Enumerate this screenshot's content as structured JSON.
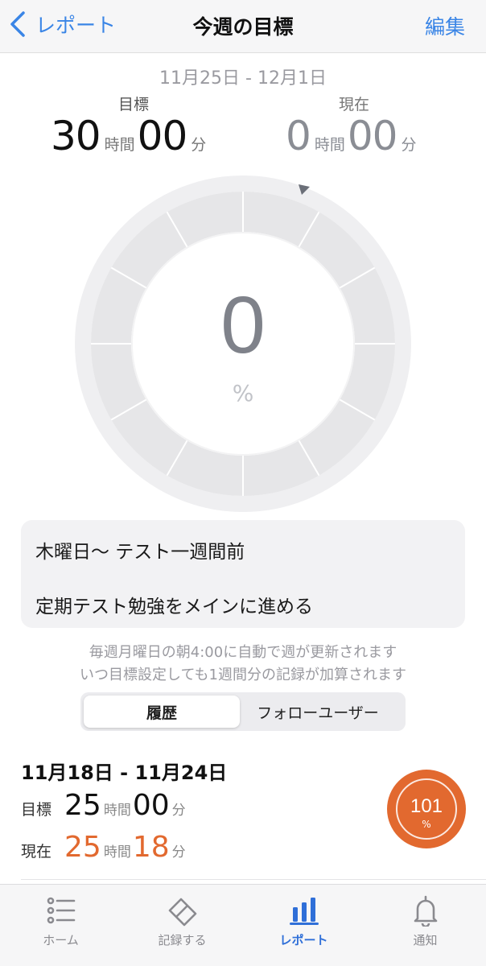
{
  "nav": {
    "back_label": "レポート",
    "title": "今週の目標",
    "edit_label": "編集"
  },
  "week": {
    "date_range": "11月25日 - 12月1日",
    "goal_label": "目標",
    "current_label": "現在",
    "goal": {
      "hours": "30",
      "minutes": "00"
    },
    "current": {
      "hours": "0",
      "minutes": "00"
    },
    "hours_unit": "時間",
    "minutes_unit": "分",
    "progress_percent": "0",
    "percent_sign": "%",
    "progress_fraction": 0
  },
  "memo": {
    "line1": "木曜日〜 テスト一週間前",
    "line2": "定期テスト勉強をメインに進める"
  },
  "notes": {
    "line1": "毎週月曜日の朝4:00に自動で週が更新されます",
    "line2": "いつ目標設定しても1週間分の記録が加算されます"
  },
  "segments": {
    "history": "履歴",
    "follow": "フォローユーザー"
  },
  "history": [
    {
      "date_range": "11月18日 - 11月24日",
      "goal_label": "目標",
      "current_label": "現在",
      "goal": {
        "hours": "25",
        "minutes": "00"
      },
      "current": {
        "hours": "25",
        "minutes": "18"
      },
      "percent": "101",
      "percent_sign": "%"
    }
  ],
  "colors": {
    "accent": "#3a85e6",
    "orange": "#e2692f",
    "ring": "#e6e6e8",
    "tab_active": "#2f6fd8"
  },
  "tabs": [
    {
      "label": "ホーム",
      "icon": "list-icon"
    },
    {
      "label": "記録する",
      "icon": "eraser-icon"
    },
    {
      "label": "レポート",
      "icon": "bar-chart-icon",
      "active": true
    },
    {
      "label": "通知",
      "icon": "bell-icon"
    }
  ]
}
